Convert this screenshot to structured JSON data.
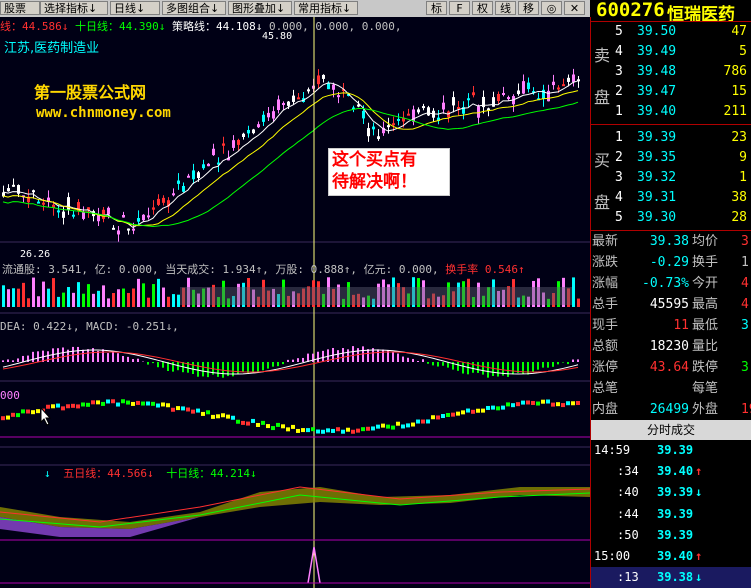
{
  "toolbar": {
    "items": [
      "股票",
      "选择指标",
      "日线",
      "多图组合",
      "图形叠加",
      "常用指标"
    ],
    "arrow": "↓",
    "right_buttons": [
      "标",
      "F",
      "权",
      "线",
      "移",
      "◎",
      "✕"
    ]
  },
  "header": {
    "stock_code": "600276",
    "stock_name": "恒瑞医药"
  },
  "kline_pane": {
    "indicator_row": [
      {
        "label": "线：",
        "value": "44.586",
        "arrow": "↓",
        "color": "#ff3030"
      },
      {
        "label": "十日线：",
        "value": "44.390",
        "arrow": "↓",
        "color": "#00ff00"
      },
      {
        "label": "策略线：",
        "value": "44.108",
        "arrow": "↓",
        "color": "#ffffff"
      },
      {
        "label": "",
        "value": "0.000, 0.000, 0.000,",
        "arrow": "",
        "color": "#c0c0c0"
      }
    ],
    "region_text": "江苏,医药制造业",
    "watermark_name": "第一股票公式网",
    "watermark_url": "www.chnmoney.com",
    "annotation_line1": "这个买点有",
    "annotation_line2": "待解决啊！",
    "high_label": "45.80",
    "low_label": "26.26"
  },
  "volume_pane": {
    "row_text": "流通股: 3.541, 亿: 0.000, 当天成交: 1.934↑, 万股: 0.888↑, 亿元: 0.000,",
    "turnover_label": "换手率",
    "turnover_value": "0.546↑"
  },
  "macd_pane": {
    "row_text": "DEA: 0.422↓, MACD: -0.251↓,"
  },
  "pane3": {
    "row_text": "000"
  },
  "pane4": {
    "five_label": "五日线：",
    "five_value": "44.566",
    "ten_label": "十日线：",
    "ten_value": "44.214",
    "arrow": "↓"
  },
  "orderbook": {
    "sell_label": [
      "卖",
      "盘"
    ],
    "buy_label": [
      "买",
      "盘"
    ],
    "sell": [
      {
        "level": "5",
        "price": "39.50",
        "volume": "47"
      },
      {
        "level": "4",
        "price": "39.49",
        "volume": "5"
      },
      {
        "level": "3",
        "price": "39.48",
        "volume": "786"
      },
      {
        "level": "2",
        "price": "39.47",
        "volume": "15"
      },
      {
        "level": "1",
        "price": "39.40",
        "volume": "211"
      }
    ],
    "buy": [
      {
        "level": "1",
        "price": "39.39",
        "volume": "23"
      },
      {
        "level": "2",
        "price": "39.35",
        "volume": "9"
      },
      {
        "level": "3",
        "price": "39.32",
        "volume": "1"
      },
      {
        "level": "4",
        "price": "39.31",
        "volume": "38"
      },
      {
        "level": "5",
        "price": "39.30",
        "volume": "28"
      }
    ]
  },
  "quote": {
    "rows": [
      {
        "l1": "最新",
        "v1": "39.38",
        "c1": "#00ffff",
        "l2": "均价",
        "v2": "3",
        "c2": "#ff3030"
      },
      {
        "l1": "涨跌",
        "v1": "-0.29",
        "c1": "#00ffff",
        "l2": "换手",
        "v2": "1.",
        "c2": "#c0c0c0"
      },
      {
        "l1": "涨幅",
        "v1": "-0.73%",
        "c1": "#00ffff",
        "l2": "今开",
        "v2": "4",
        "c2": "#ff3030"
      },
      {
        "l1": "总手",
        "v1": "45595",
        "c1": "#ffffff",
        "l2": "最高",
        "v2": "4",
        "c2": "#ff3030"
      },
      {
        "l1": "现手",
        "v1": "11",
        "c1": "#ff3030",
        "l2": "最低",
        "v2": "3",
        "c2": "#00ffff"
      },
      {
        "l1": "总额",
        "v1": "18230",
        "c1": "#ffffff",
        "l2": "量比",
        "v2": "",
        "c2": "#c0c0c0"
      },
      {
        "l1": "涨停",
        "v1": "43.64",
        "c1": "#ff3030",
        "l2": "跌停",
        "v2": "3",
        "c2": "#00ff00"
      },
      {
        "l1": "总笔",
        "v1": "",
        "c1": "#ffffff",
        "l2": "每笔",
        "v2": "",
        "c2": "#c0c0c0"
      },
      {
        "l1": "内盘",
        "v1": "26499",
        "c1": "#00ffff",
        "l2": "外盘",
        "v2": "19",
        "c2": "#ff3030"
      }
    ]
  },
  "ticks": {
    "title": "分时成交",
    "rows": [
      {
        "time": "14:59",
        "price": "39.39",
        "arrow": "",
        "acolor": "#00ffff"
      },
      {
        "time": ":34",
        "price": "39.40",
        "arrow": "↑",
        "acolor": "#ff3030"
      },
      {
        "time": ":40",
        "price": "39.39",
        "arrow": "↓",
        "acolor": "#00ffff"
      },
      {
        "time": ":44",
        "price": "39.39",
        "arrow": "",
        "acolor": "#00ffff"
      },
      {
        "time": ":50",
        "price": "39.39",
        "arrow": "",
        "acolor": "#00ffff"
      },
      {
        "time": "15:00",
        "price": "39.40",
        "arrow": "↑",
        "acolor": "#ff3030"
      },
      {
        "time": ":13",
        "price": "39.38",
        "arrow": "↓",
        "acolor": "#00ffff"
      }
    ]
  },
  "colors": {
    "up": "#ff3030",
    "down": "#00ffff",
    "pink": "#ff80ff",
    "ma_white": "#ffffff",
    "ma_yellow": "#ffff00",
    "grid": "#3a2a5a",
    "accent_panel": "#00ffff"
  }
}
